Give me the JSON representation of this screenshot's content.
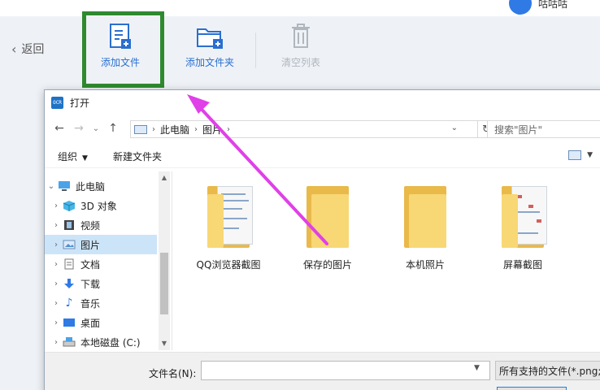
{
  "app": {
    "username": "咕咕咕",
    "back_label": "返回",
    "toolbar": {
      "add_file": "添加文件",
      "add_folder": "添加文件夹",
      "clear_list": "清空列表"
    }
  },
  "dialog": {
    "title": "打开",
    "icon_text": "OCR",
    "breadcrumb": [
      "此电脑",
      "图片"
    ],
    "search_placeholder": "搜索\"图片\"",
    "commands": {
      "organize": "组织",
      "new_folder": "新建文件夹"
    },
    "tree": [
      {
        "label": "此电脑",
        "icon": "pc-icon"
      },
      {
        "label": "3D 对象",
        "icon": "cube-3d-icon"
      },
      {
        "label": "视频",
        "icon": "video-icon"
      },
      {
        "label": "图片",
        "icon": "pictures-icon"
      },
      {
        "label": "文档",
        "icon": "documents-icon"
      },
      {
        "label": "下载",
        "icon": "download-icon"
      },
      {
        "label": "音乐",
        "icon": "music-icon"
      },
      {
        "label": "桌面",
        "icon": "desktop-icon"
      },
      {
        "label": "本地磁盘 (C:)",
        "icon": "drive-icon"
      }
    ],
    "folders": [
      {
        "name": "QQ浏览器截图"
      },
      {
        "name": "保存的图片"
      },
      {
        "name": "本机照片"
      },
      {
        "name": "屏幕截图"
      }
    ],
    "file_name_label": "文件名(N):",
    "file_name_value": "",
    "file_type_filter": "所有支持的文件(*.png;*"
  },
  "colors": {
    "highlight_box": "#2f8a2f",
    "arrow": "#e040e8",
    "accent": "#2a6fcf",
    "selected_row": "#cce4f7"
  }
}
